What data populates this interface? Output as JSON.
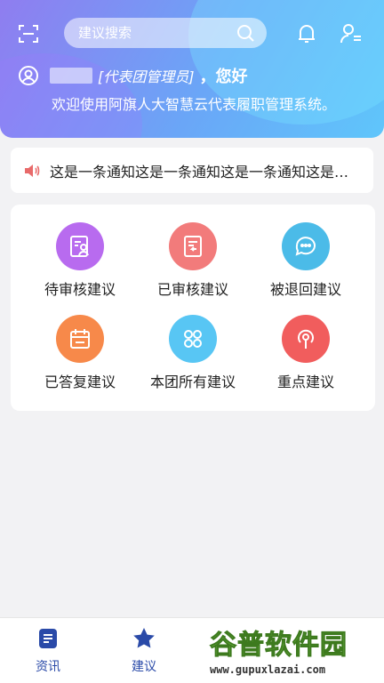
{
  "search": {
    "placeholder": "建议搜索"
  },
  "greeting": {
    "role": "[代表团管理员]",
    "hello": "，您好",
    "welcome": "欢迎使用阿旗人大智慧云代表履职管理系统。"
  },
  "notice": {
    "text": "这是一条通知这是一条通知这是一条通知这是一条通知"
  },
  "menu": [
    {
      "label": "待审核建议",
      "icon": "review-person-icon",
      "color": "#b86bef"
    },
    {
      "label": "已审核建议",
      "icon": "doc-return-icon",
      "color": "#f27b7b"
    },
    {
      "label": "被退回建议",
      "icon": "chat-bubble-icon",
      "color": "#4bbbe8"
    },
    {
      "label": "已答复建议",
      "icon": "calendar-icon",
      "color": "#f7894a"
    },
    {
      "label": "本团所有建议",
      "icon": "clover-icon",
      "color": "#58c6f4"
    },
    {
      "label": "重点建议",
      "icon": "signal-pin-icon",
      "color": "#f15d5d"
    }
  ],
  "tabs": [
    {
      "label": "资讯",
      "icon": "document-icon"
    },
    {
      "label": "建议",
      "icon": "star-icon"
    }
  ],
  "watermark": {
    "title": "谷普软件园",
    "url": "www.gupuxlazai.com"
  },
  "colors": {
    "tab_active": "#2a4aa8",
    "speaker": "#e86a6a"
  }
}
